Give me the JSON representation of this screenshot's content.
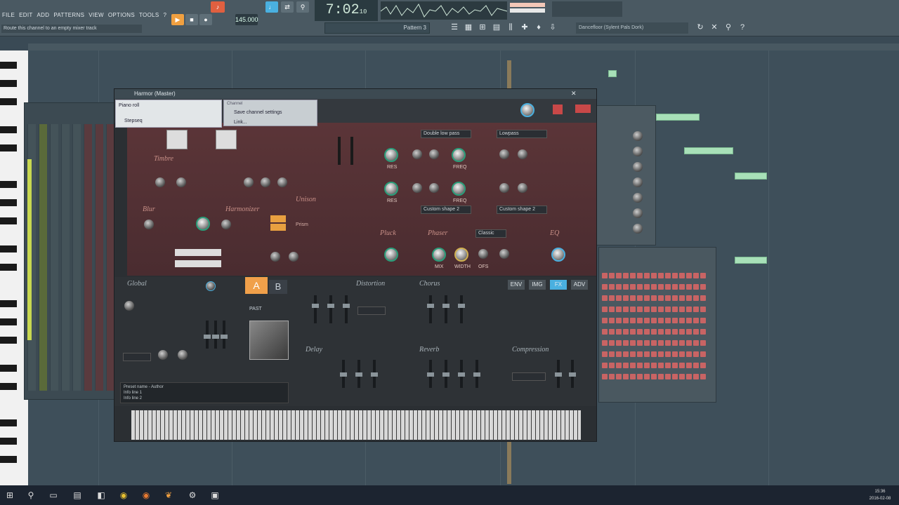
{
  "menu": [
    "FILE",
    "EDIT",
    "ADD",
    "PATTERNS",
    "VIEW",
    "OPTIONS",
    "TOOLS",
    "?"
  ],
  "hint_bar": "Route this channel to an empty mixer track",
  "transport": {
    "tempo": "145.000",
    "time": "7:02",
    "time_sub": "10"
  },
  "pattern_label": "Pattern 3",
  "preset_label": "Dancefloor (Sylent Pals Dork)",
  "harmor": {
    "title": "Harmor (Master)",
    "sections": {
      "timbre": "Timbre",
      "harmonizer": "Harmonizer",
      "unison": "Unison",
      "pluck": "Pluck",
      "phaser": "Phaser",
      "eq": "EQ",
      "blur": "Blur",
      "global": "Global",
      "distortion": "Distortion",
      "chorus": "Chorus",
      "delay": "Delay",
      "reverb": "Reverb",
      "compression": "Compression",
      "prism": "Prism"
    },
    "filter1": "Double low pass",
    "filter2": "Lowpass",
    "shape1": "Custom shape 2",
    "shape2": "Custom shape 2",
    "phaser_mode": "Classic",
    "knob_labels": [
      "RES",
      "FREQ",
      "RES",
      "FREQ",
      "MIX",
      "WIDTH",
      "OFS"
    ],
    "ab": {
      "a": "A",
      "b": "B"
    },
    "tabs": [
      "ENV",
      "IMG",
      "FX",
      "ADV"
    ],
    "past_label": "PAST",
    "preset_info": {
      "line1": "Preset name - Author",
      "line2": "Info line 1",
      "line3": "Info line 2"
    }
  },
  "context_menu": {
    "left": [
      "Piano roll",
      "Stepseq"
    ],
    "right_header": "Channel",
    "right": [
      "Save channel settings",
      "Link..."
    ]
  },
  "clock": {
    "time": "15:36",
    "date": "2016-02-08"
  },
  "taskbar_icons": [
    "windows-icon",
    "search-icon",
    "task-view-icon",
    "file-explorer-icon",
    "store-icon",
    "chrome-icon",
    "firefox-icon",
    "fl-studio-icon",
    "settings-icon",
    "photos-icon"
  ]
}
